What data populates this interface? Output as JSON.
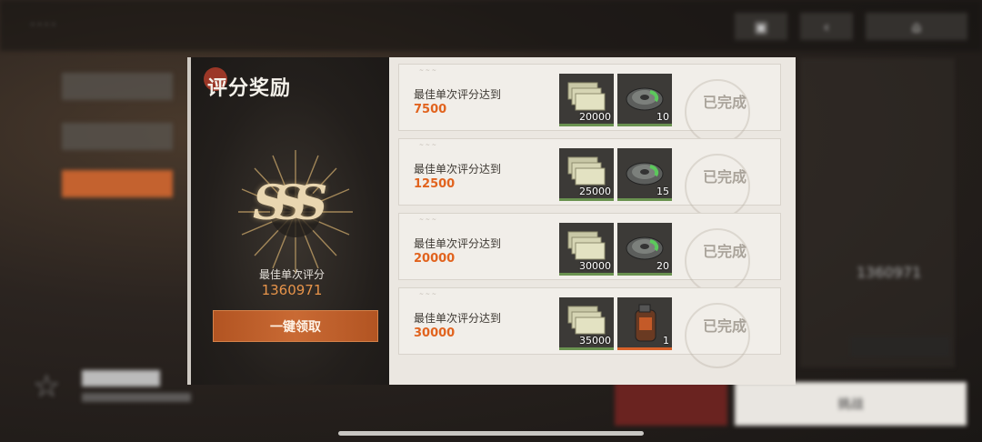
{
  "modal": {
    "title": "评分奖励",
    "rank": "SSS",
    "best_label": "最佳单次评分",
    "best_score": "1360971",
    "claim_button": "一键领取"
  },
  "rewards": [
    {
      "label": "最佳单次评分达到",
      "target": "7500",
      "items": [
        {
          "icon": "ticket-icon",
          "qty": "20000"
        },
        {
          "icon": "disc-icon",
          "qty": "10"
        }
      ],
      "status": "已完成"
    },
    {
      "label": "最佳单次评分达到",
      "target": "12500",
      "items": [
        {
          "icon": "ticket-icon",
          "qty": "25000"
        },
        {
          "icon": "disc-icon",
          "qty": "15"
        }
      ],
      "status": "已完成"
    },
    {
      "label": "最佳单次评分达到",
      "target": "20000",
      "items": [
        {
          "icon": "ticket-icon",
          "qty": "30000"
        },
        {
          "icon": "disc-icon",
          "qty": "20"
        }
      ],
      "status": "已完成"
    },
    {
      "label": "最佳单次评分达到",
      "target": "30000",
      "items": [
        {
          "icon": "ticket-icon",
          "qty": "35000"
        },
        {
          "icon": "canister-icon",
          "qty": "1"
        }
      ],
      "status": "已完成"
    }
  ],
  "background": {
    "right_score": "1360971",
    "bottom_button": "挑战"
  },
  "colors": {
    "accent_orange": "#e1631e",
    "claim_button": "#c96a34",
    "item_bar_green": "#6a9250",
    "item_bar_orange": "#d9622a"
  }
}
